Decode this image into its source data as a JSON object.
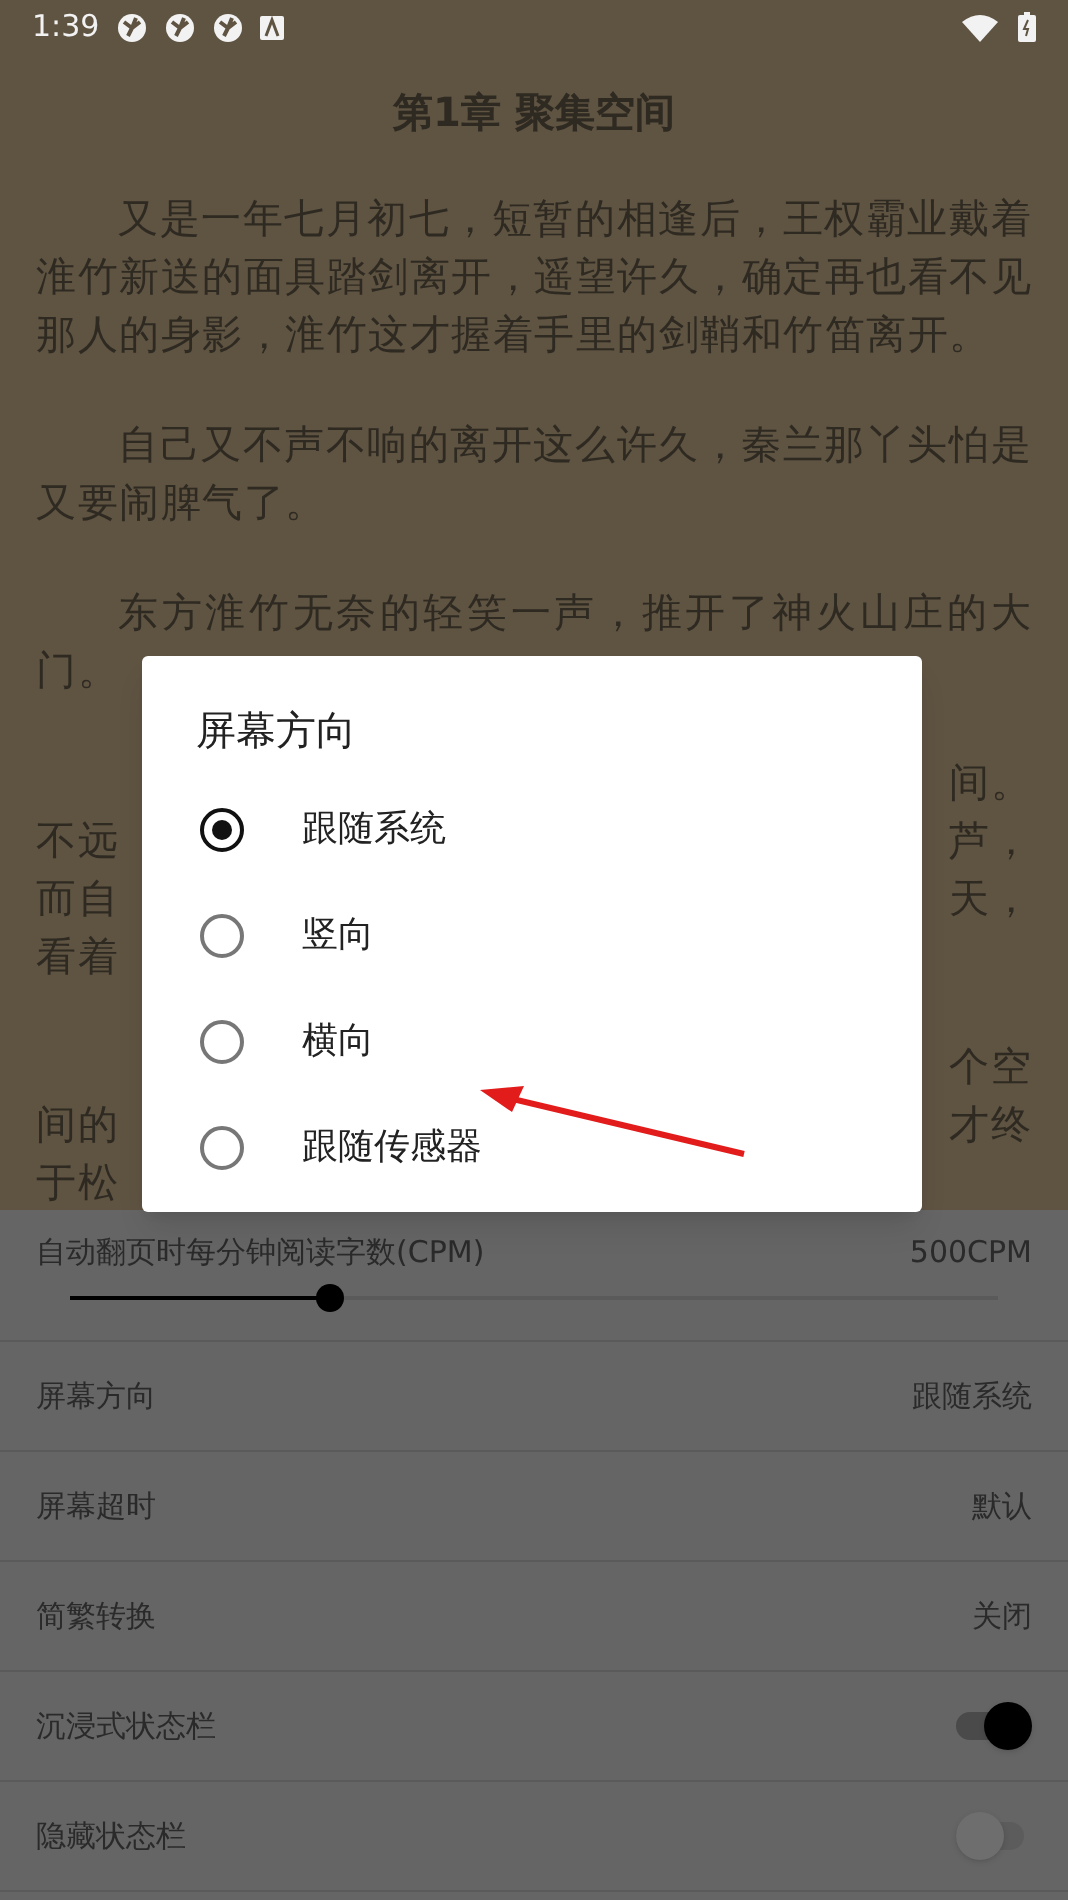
{
  "status_bar": {
    "time": "1:39"
  },
  "chapter": {
    "title": "第1章 聚集空间",
    "paragraphs": [
      "又是一年七月初七，短暂的相逢后，王权霸业戴着淮竹新送的面具踏剑离开，遥望许久，确定再也看不见那人的身影，淮竹这才握着手里的剑鞘和竹笛离开。",
      "自己又不声不响的离开这么许久，秦兰那丫头怕是又要闹脾气了。",
      "东方淮竹无奈的轻笑一声，推开了神火山庄的大门。"
    ],
    "covered_paragraphs": [
      {
        "lines": [
          {
            "right": "间。"
          },
          {
            "left": "不远",
            "right": "芦，"
          },
          {
            "left": "而自",
            "right": "天，"
          },
          {
            "left": "看着"
          }
        ]
      },
      {
        "lines": [
          {
            "right": "个空"
          },
          {
            "left": "间的",
            "right": "才终"
          },
          {
            "left": "于松"
          }
        ]
      }
    ]
  },
  "settings": {
    "slider": {
      "label": "自动翻页时每分钟阅读字数(CPM)",
      "value": "500CPM",
      "level": 0.28
    },
    "rows": [
      {
        "kind": "value",
        "label": "屏幕方向",
        "value": "跟随系统"
      },
      {
        "kind": "value",
        "label": "屏幕超时",
        "value": "默认"
      },
      {
        "kind": "value",
        "label": "简繁转换",
        "value": "关闭"
      },
      {
        "kind": "toggle",
        "label": "沉浸式状态栏",
        "on": true
      },
      {
        "kind": "toggle",
        "label": "隐藏状态栏",
        "on": false
      }
    ]
  },
  "dialog": {
    "title": "屏幕方向",
    "options": [
      {
        "label": "跟随系统",
        "selected": true
      },
      {
        "label": "竖向",
        "selected": false
      },
      {
        "label": "横向",
        "selected": false
      },
      {
        "label": "跟随传感器",
        "selected": false
      }
    ]
  }
}
